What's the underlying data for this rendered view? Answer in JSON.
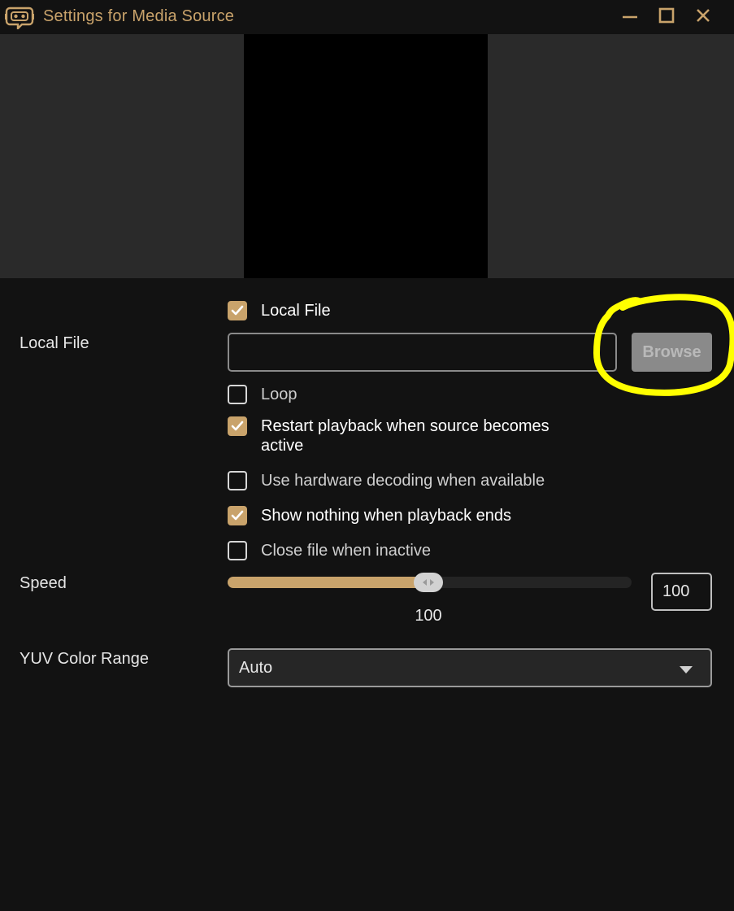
{
  "window": {
    "title": "Settings for Media Source",
    "icons": {
      "app": "streamlabs-robot-icon",
      "minimize": "minimize-icon",
      "maximize": "maximize-icon",
      "close": "close-icon"
    }
  },
  "colors": {
    "accent": "#c9a36b",
    "background": "#121212",
    "preview_bg": "#2a2a2a",
    "highlight": "#ffff00"
  },
  "form": {
    "local_file_checkbox": {
      "label": "Local File",
      "checked": true
    },
    "local_file": {
      "label": "Local File",
      "value": "",
      "browse_label": "Browse"
    },
    "options": [
      {
        "label": "Loop",
        "checked": false
      },
      {
        "label": "Restart playback when source becomes active",
        "checked": true
      },
      {
        "label": "Use hardware decoding when available",
        "checked": false
      },
      {
        "label": "Show nothing when playback ends",
        "checked": true
      },
      {
        "label": "Close file when inactive",
        "checked": false
      }
    ],
    "speed": {
      "label": "Speed",
      "value": "100",
      "display": "100",
      "input_value": "100",
      "fill_fraction": 0.496
    },
    "yuv_color_range": {
      "label": "YUV Color Range",
      "selected": "Auto"
    }
  }
}
